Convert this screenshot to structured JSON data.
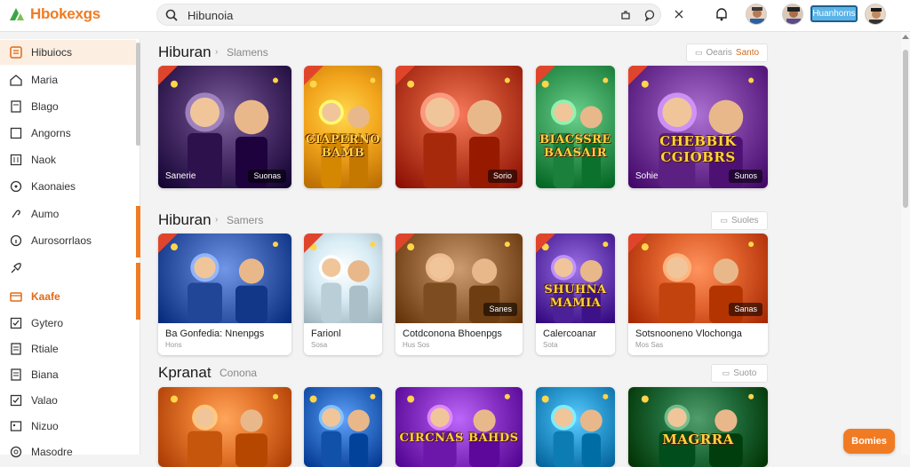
{
  "app": {
    "logo_text": "Hbokexgs"
  },
  "search": {
    "value": "Hibunoia"
  },
  "header": {
    "pill_label": "Huanhoms"
  },
  "sidebar": {
    "items": [
      {
        "label": "Hibuiocs",
        "icon": "list-icon"
      },
      {
        "label": "Maria",
        "icon": "home-icon"
      },
      {
        "label": "Blago",
        "icon": "book-icon"
      },
      {
        "label": "Angorns",
        "icon": "square-icon"
      },
      {
        "label": "Naok",
        "icon": "grid-icon"
      },
      {
        "label": "Kaonaies",
        "icon": "clock-icon"
      },
      {
        "label": "Aumo",
        "icon": "link-icon"
      },
      {
        "label": "Aurosorrlaos",
        "icon": "info-icon"
      },
      {
        "label": "",
        "icon": "rocket-icon"
      },
      {
        "label": "Kaafe",
        "icon": "box-icon"
      },
      {
        "label": "Gytero",
        "icon": "checkbox-icon"
      },
      {
        "label": "Rtiale",
        "icon": "doc-icon"
      },
      {
        "label": "Biana",
        "icon": "doc-icon"
      },
      {
        "label": "Valao",
        "icon": "check-icon"
      },
      {
        "label": "Nizuo",
        "icon": "image-icon"
      },
      {
        "label": "Masodre",
        "icon": "target-icon"
      }
    ]
  },
  "sections": [
    {
      "title": "Hiburan",
      "subtitle": "Slamens",
      "button_label": "Oearis",
      "button_label_accent": "Santo",
      "cards": [
        {
          "art_text": "",
          "caption": "Sanerie",
          "tag": "Suonas",
          "theme": "#4b2f6a"
        },
        {
          "art_text": "CIAPERNO BAMB",
          "caption": "",
          "tag": "",
          "theme": "#f2a51c"
        },
        {
          "art_text": "",
          "caption": "",
          "tag": "Sorio",
          "theme": "#c4472a"
        },
        {
          "art_text": "BIACSSRE BAASAIR",
          "caption": "",
          "tag": "",
          "theme": "#3a9e5b"
        },
        {
          "art_text": "CHEBBIK CGIOBRS",
          "caption": "Sohie",
          "tag": "Sunos",
          "theme": "#7a3ea0"
        }
      ]
    },
    {
      "title": "Hiburan",
      "subtitle": "Samers",
      "button_label": "Suoles",
      "cards": [
        {
          "art_text": "",
          "meta_title": "Ba Gonfedia:  Nnenpgs",
          "meta_sub": "Hons",
          "tag": "",
          "theme": "#3f63b5"
        },
        {
          "art_text": "",
          "meta_title": "Farionl",
          "meta_sub": "Sosa",
          "tag": "",
          "theme": "#d8ecf5"
        },
        {
          "art_text": "",
          "meta_title": "Cotdconona  Bhoenpgs",
          "meta_sub": "Hus Sos",
          "tag": "Sanes",
          "theme": "#9b6a3e"
        },
        {
          "art_text": "SHUHNA MAMIA",
          "meta_title": "Calercoanar",
          "meta_sub": "Sota",
          "tag": "",
          "theme": "#6a3fb5"
        },
        {
          "art_text": "",
          "meta_title": "Sotsnooneno Vlochonga",
          "meta_sub": "Mos Sas",
          "tag": "Sanas",
          "theme": "#e0612c"
        }
      ]
    },
    {
      "title": "Kpranat",
      "subtitle": "Conona",
      "button_label": "Suoto",
      "cards": [
        {
          "art_text": "",
          "theme": "#e3742a"
        },
        {
          "art_text": "",
          "theme": "#2f6fc8"
        },
        {
          "art_text": "CIRCNAS BAHDS",
          "theme": "#8a34c8"
        },
        {
          "art_text": "",
          "theme": "#2b9ad1"
        },
        {
          "art_text": "MAGRRA",
          "theme": "#1f6b3a"
        }
      ]
    }
  ],
  "fab": {
    "label": "Bomies"
  },
  "colors": {
    "accent": "#f07b23",
    "pill": "#5ab4e9"
  }
}
